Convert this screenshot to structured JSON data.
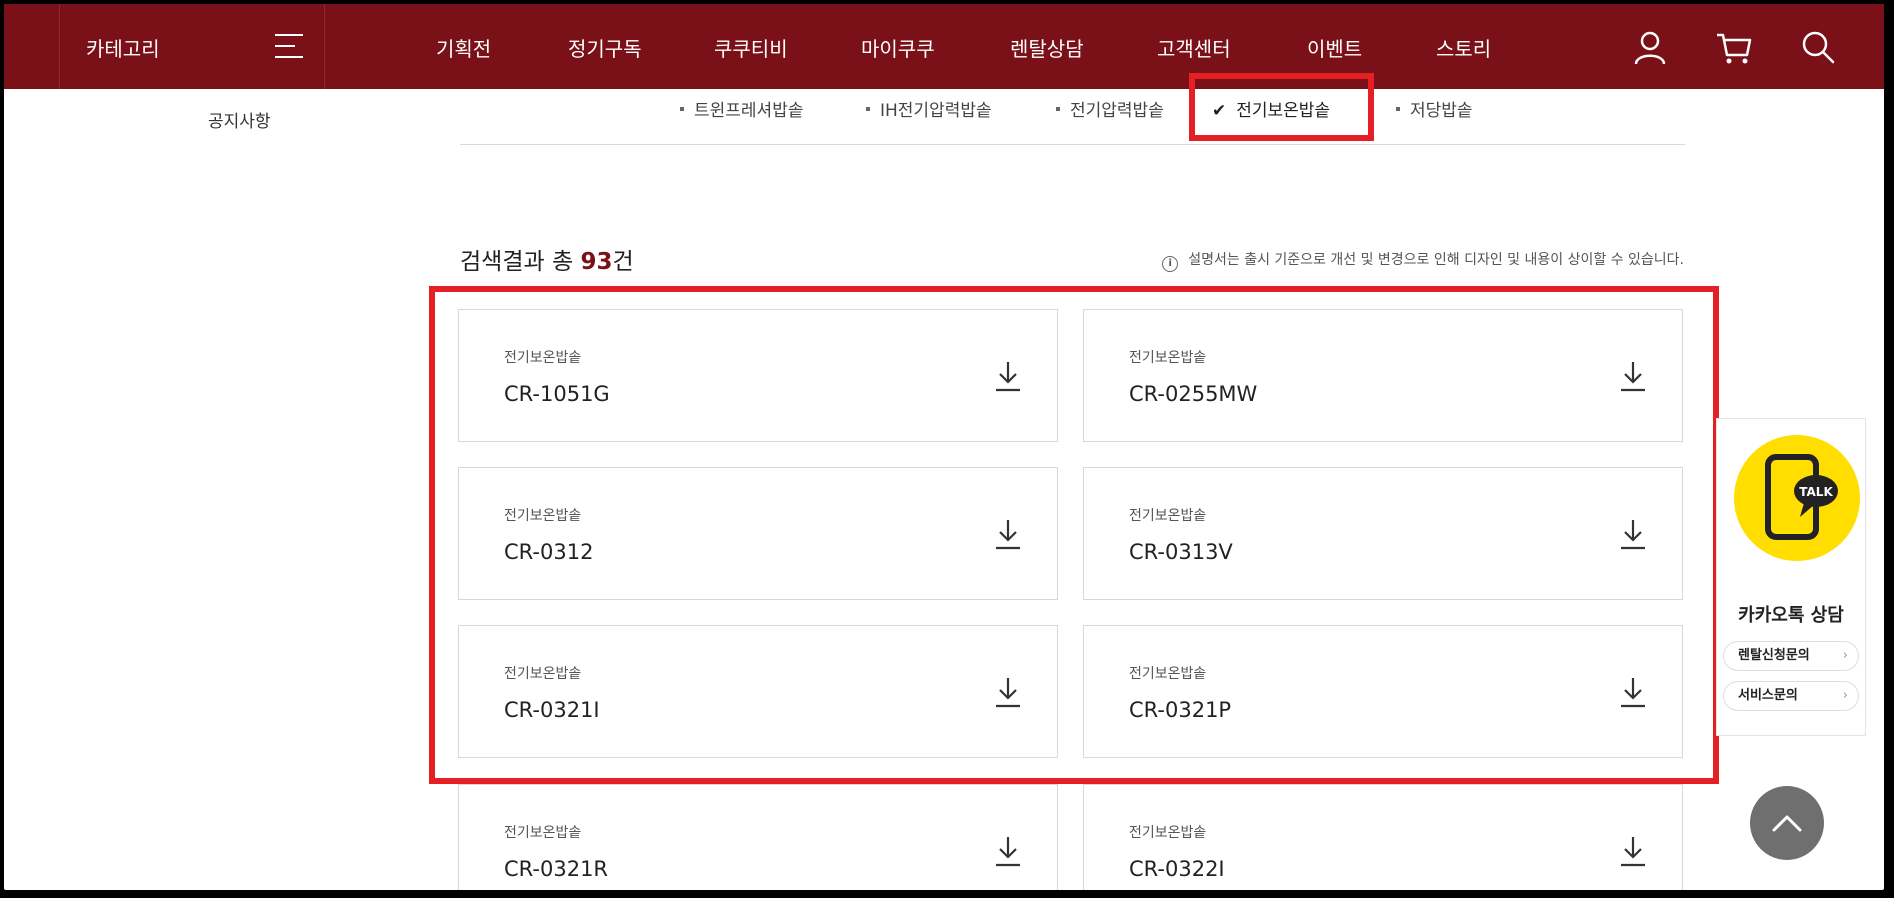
{
  "header": {
    "category_label": "카테고리",
    "nav": [
      "기획전",
      "정기구독",
      "쿠쿠티비",
      "마이쿠쿠",
      "렌탈상담",
      "고객센터",
      "이벤트",
      "스토리"
    ],
    "icons": [
      "user-icon",
      "cart-icon",
      "search-icon"
    ]
  },
  "sidebar": {
    "notice_link": "공지사항"
  },
  "subtabs": [
    {
      "label": "트윈프레셔밥솥",
      "active": false
    },
    {
      "label": "IH전기압력밥솥",
      "active": false
    },
    {
      "label": "전기압력밥솥",
      "active": false
    },
    {
      "label": "전기보온밥솥",
      "active": true
    },
    {
      "label": "저당밥솥",
      "active": false
    }
  ],
  "results": {
    "prefix": "검색결과 총",
    "count": "93",
    "suffix": "건",
    "notice": "설명서는 출시 기준으로 개선 및 변경으로 인해 디자인 및 내용이 상이할 수 있습니다."
  },
  "cards": [
    {
      "category": "전기보온밥솥",
      "model": "CR-1051G"
    },
    {
      "category": "전기보온밥솥",
      "model": "CR-0255MW"
    },
    {
      "category": "전기보온밥솥",
      "model": "CR-0312"
    },
    {
      "category": "전기보온밥솥",
      "model": "CR-0313V"
    },
    {
      "category": "전기보온밥솥",
      "model": "CR-0321I"
    },
    {
      "category": "전기보온밥솥",
      "model": "CR-0321P"
    },
    {
      "category": "전기보온밥솥",
      "model": "CR-0321R"
    },
    {
      "category": "전기보온밥솥",
      "model": "CR-0322I"
    }
  ],
  "kakao": {
    "badge": "TALK",
    "title": "카카오톡 상담",
    "rental_button": "렌탈신청문의",
    "service_button": "서비스문의"
  },
  "colors": {
    "brand": "#7a1018",
    "highlight": "#e52025",
    "kakao": "#ffde00"
  }
}
